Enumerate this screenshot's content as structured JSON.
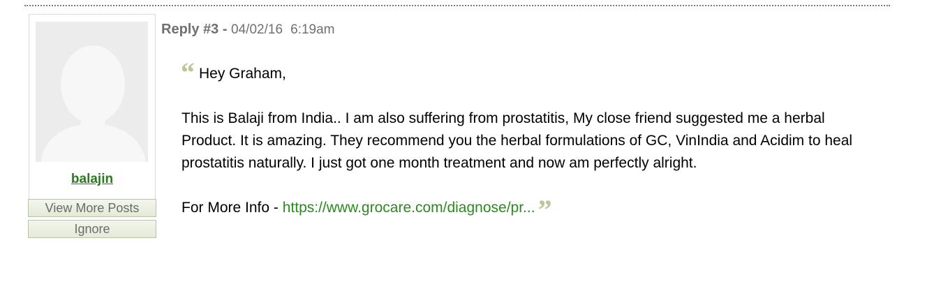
{
  "post": {
    "reply_label": "Reply #3 -",
    "date": "04/02/16",
    "time": "6:19am",
    "greeting": "Hey Graham,",
    "paragraph": "This is Balaji from India.. I am also suffering from prostatitis, My close friend suggested me a herbal Product. It is amazing. They recommend you the herbal formulations of GC, VinIndia and Acidim to heal prostatitis naturally. I just got one month treatment and now am perfectly alright.",
    "info_prefix": "For More Info -",
    "info_link": "https://www.grocare.com/diagnose/pr...",
    "open_quote": "“",
    "close_quote": "”"
  },
  "author": {
    "username": "balajin",
    "view_posts_label": "View More Posts",
    "ignore_label": "Ignore"
  },
  "colors": {
    "link_green": "#2a8a1e",
    "quote_green": "#b9c795",
    "button_border": "#b8c4a6"
  },
  "icons": {
    "avatar": "default-user-silhouette-icon",
    "open_quote": "open-quote-icon",
    "close_quote": "close-quote-icon"
  }
}
